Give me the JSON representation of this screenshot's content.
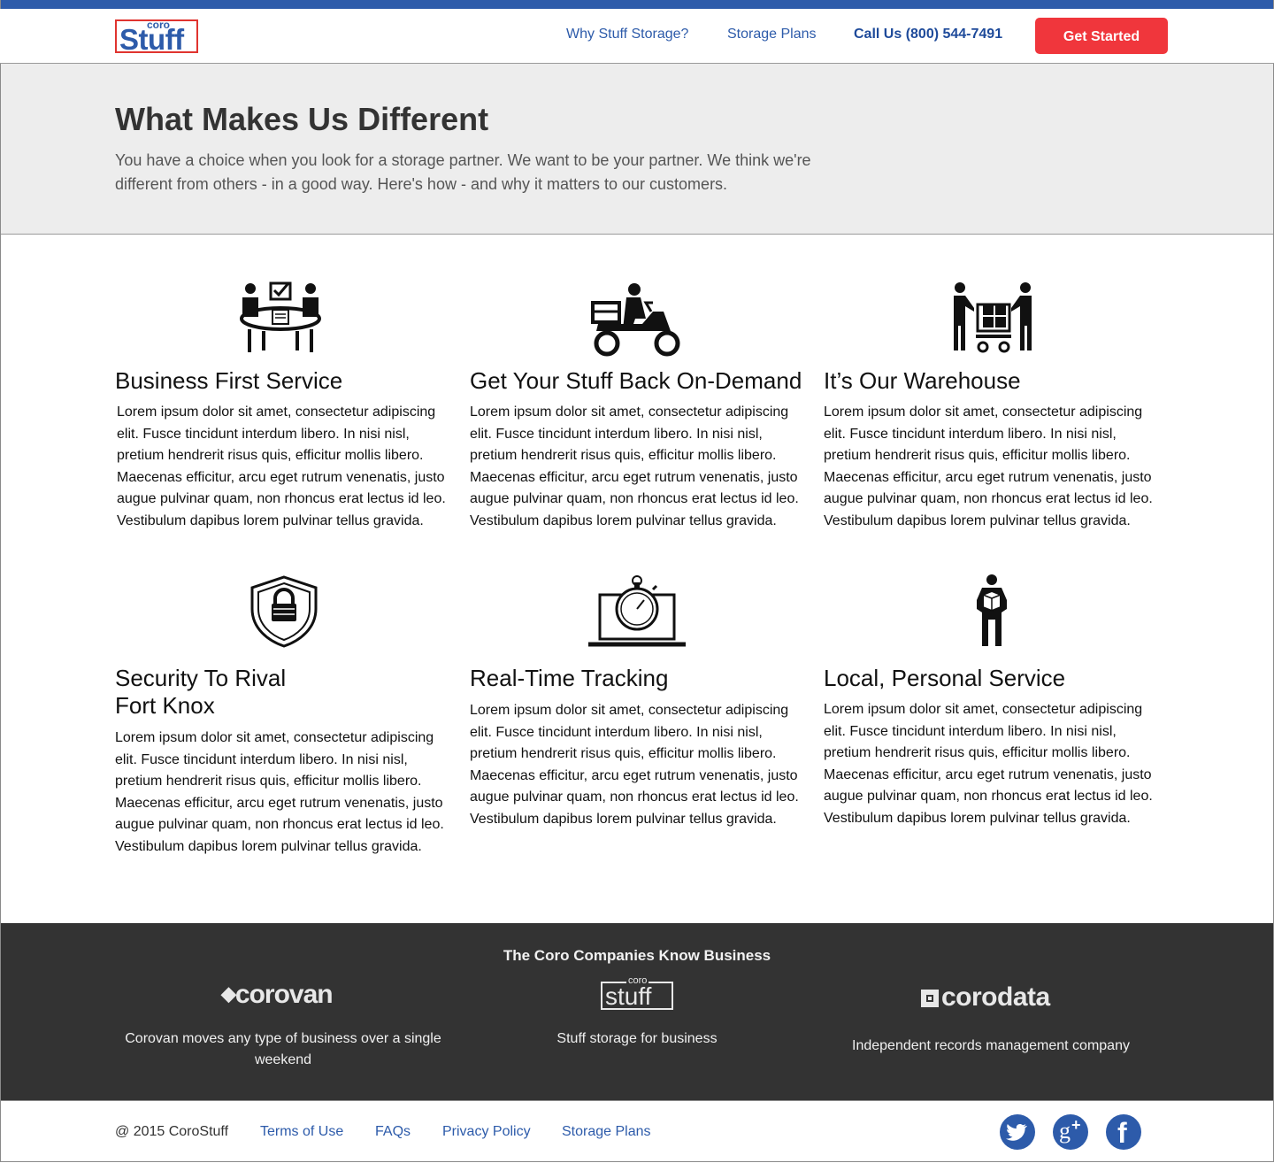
{
  "header": {
    "logo": {
      "top": "coro",
      "main": "Stuff"
    },
    "nav": {
      "why": "Why Stuff Storage?",
      "plans": "Storage Plans",
      "call": "Call Us (800) 544-7491"
    },
    "cta": "Get Started"
  },
  "hero": {
    "title": "What Makes Us Different",
    "text": "You have a choice when you look for a storage partner. We want to be your partner. We think we're different from others - in a good way. Here's how - and why it matters to our customers."
  },
  "features": [
    {
      "title": "Business First Service",
      "icon": "meeting-table-icon",
      "body": "Lorem ipsum dolor sit amet, consectetur adipiscing elit. Fusce tincidunt interdum libero. In nisi nisl, pretium hendrerit risus quis, efficitur mollis libero. Maecenas efficitur, arcu eget rutrum venenatis, justo augue pulvinar quam, non rhoncus erat lectus id leo. Vestibulum dapibus lorem pulvinar tellus gravida."
    },
    {
      "title": "Get Your Stuff Back On-Demand",
      "icon": "delivery-scooter-icon",
      "body": "Lorem ipsum dolor sit amet, consectetur adipiscing elit. Fusce tincidunt interdum libero. In nisi nisl, pretium hendrerit risus quis, efficitur mollis libero. Maecenas efficitur, arcu eget rutrum venenatis, justo augue pulvinar quam, non rhoncus erat lectus id leo. Vestibulum dapibus lorem pulvinar tellus gravida."
    },
    {
      "title": "It’s Our Warehouse",
      "icon": "warehouse-cart-icon",
      "body": "Lorem ipsum dolor sit amet, consectetur adipiscing elit. Fusce tincidunt interdum libero. In nisi nisl, pretium hendrerit risus quis, efficitur mollis libero. Maecenas efficitur, arcu eget rutrum venenatis, justo augue pulvinar quam, non rhoncus erat lectus id leo. Vestibulum dapibus lorem pulvinar tellus gravida."
    },
    {
      "title_line1": "Security To Rival",
      "title_line2": "Fort Knox",
      "icon": "shield-lock-icon",
      "body": "Lorem ipsum dolor sit amet, consectetur adipiscing elit. Fusce tincidunt interdum libero. In nisi nisl, pretium hendrerit risus quis, efficitur mollis libero. Maecenas efficitur, arcu eget rutrum venenatis, justo augue pulvinar quam, non rhoncus erat lectus id leo. Vestibulum dapibus lorem pulvinar tellus gravida."
    },
    {
      "title": "Real-Time Tracking",
      "icon": "laptop-stopwatch-icon",
      "body": "Lorem ipsum dolor sit amet, consectetur adipiscing elit. Fusce tincidunt interdum libero. In nisi nisl, pretium hendrerit risus quis, efficitur mollis libero. Maecenas efficitur, arcu eget rutrum venenatis, justo augue pulvinar quam, non rhoncus erat lectus id leo. Vestibulum dapibus lorem pulvinar tellus gravida."
    },
    {
      "title": "Local, Personal Service",
      "icon": "person-with-box-icon",
      "body": "Lorem ipsum dolor sit amet, consectetur adipiscing elit. Fusce tincidunt interdum libero. In nisi nisl, pretium hendrerit risus quis, efficitur mollis libero. Maecenas efficitur, arcu eget rutrum venenatis, justo augue pulvinar quam, non rhoncus erat lectus id leo. Vestibulum dapibus lorem pulvinar tellus gravida."
    }
  ],
  "companies": {
    "heading": "The Coro Companies Know Business",
    "items": [
      {
        "logo": "corovan",
        "desc": "Corovan moves any type of business over a single weekend"
      },
      {
        "logo_top": "coro",
        "logo": "stuff",
        "desc": "Stuff storage for business"
      },
      {
        "logo": "corodata",
        "desc": "Independent records management company"
      }
    ]
  },
  "footer": {
    "copyright": "@ 2015 CoroStuff",
    "links": [
      "Terms of Use",
      "FAQs",
      "Privacy Policy",
      "Storage Plans"
    ],
    "social": [
      "twitter-icon",
      "google-plus-icon",
      "facebook-icon"
    ]
  },
  "colors": {
    "brand_blue": "#2d5baa",
    "cta_red": "#f0363c",
    "hero_bg": "#ededed",
    "footer_bg": "#333333"
  }
}
